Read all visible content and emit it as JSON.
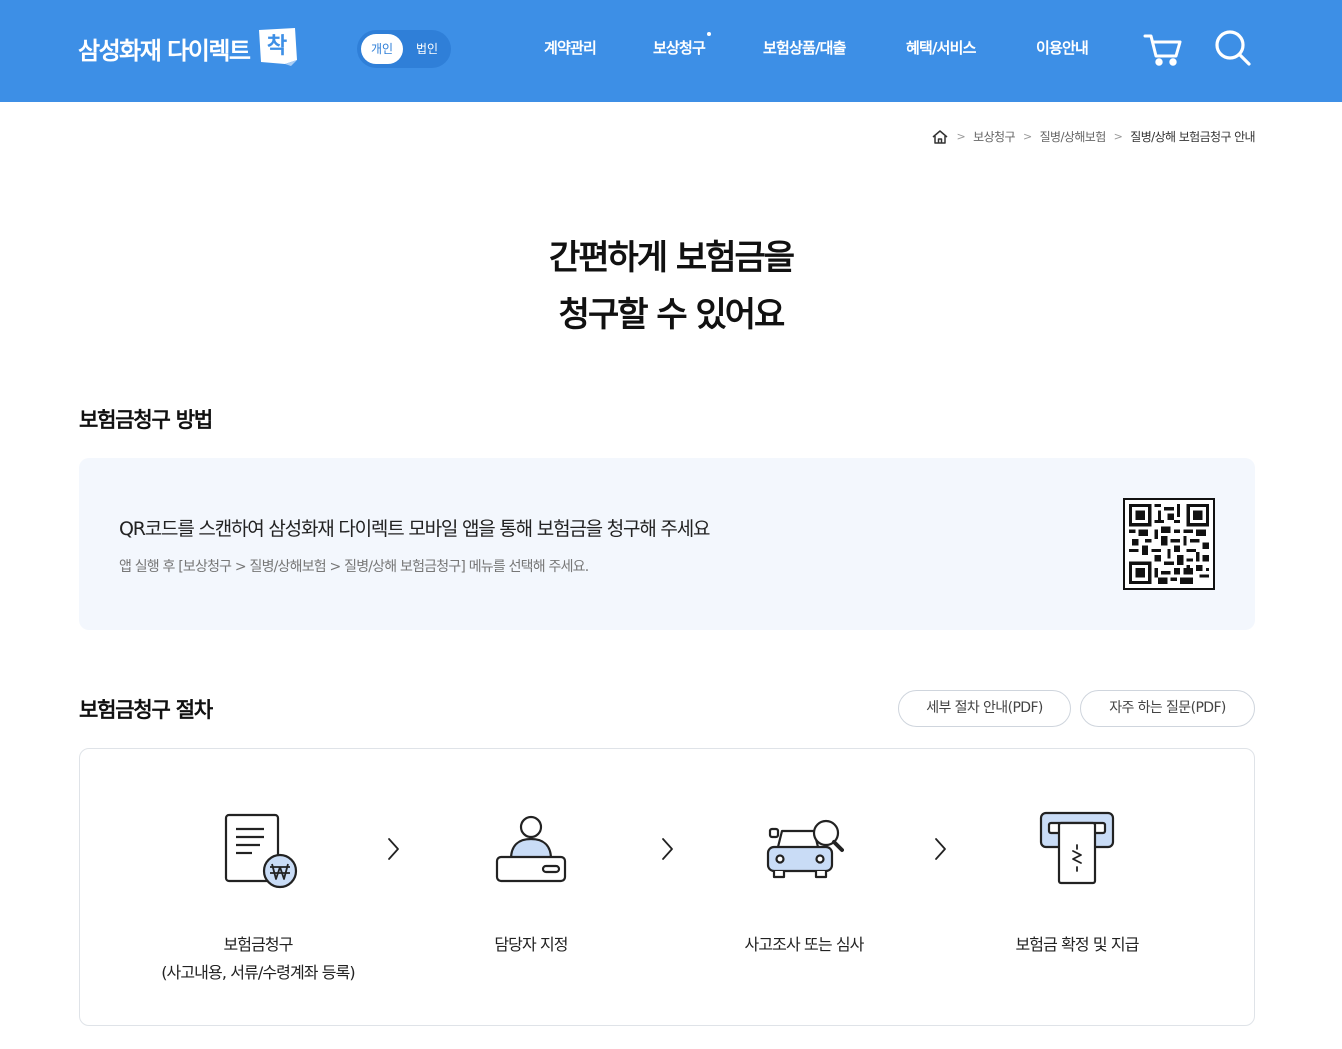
{
  "header": {
    "logo_text": "삼성화재 다이렉트",
    "logo_badge": "착",
    "toggle": {
      "personal": "개인",
      "corporate": "법인"
    },
    "nav": [
      {
        "label": "계약관리",
        "has_dot": false
      },
      {
        "label": "보상청구",
        "has_dot": true
      },
      {
        "label": "보험상품/대출",
        "has_dot": false
      },
      {
        "label": "혜택/서비스",
        "has_dot": false
      },
      {
        "label": "이용안내",
        "has_dot": false
      }
    ],
    "icons": {
      "cart": "cart-icon",
      "search": "search-icon"
    }
  },
  "breadcrumb": {
    "home_icon": "home-icon",
    "items": [
      "보상청구",
      "질병/상해보험",
      "질병/상해 보험금청구 안내"
    ]
  },
  "hero": {
    "line1": "간편하게 보험금을",
    "line2": "청구할 수 있어요"
  },
  "method": {
    "title": "보험금청구 방법",
    "main_text": "QR코드를 스캔하여 삼성화재 다이렉트 모바일 앱을 통해 보험금을 청구해 주세요",
    "sub_text": "앱 실행 후 [보상청구 > 질병/상해보험 > 질병/상해 보험금청구] 메뉴를 선택해 주세요.",
    "qr_icon": "qr-code"
  },
  "procedure": {
    "title": "보험금청구 절차",
    "buttons": {
      "detail_pdf": "세부 절차 안내(PDF)",
      "faq_pdf": "자주 하는 질문(PDF)"
    },
    "steps": [
      {
        "line1": "보험금청구",
        "line2": "(사고내용, 서류/수령계좌 등록)",
        "icon": "document-won-icon"
      },
      {
        "line1": "담당자 지정",
        "line2": "",
        "icon": "person-desk-icon"
      },
      {
        "line1": "사고조사 또는 심사",
        "line2": "",
        "icon": "car-magnifier-icon"
      },
      {
        "line1": "보험금 확정 및 지급",
        "line2": "",
        "icon": "receipt-payout-icon"
      }
    ]
  },
  "colors": {
    "brand": "#3d8fe6",
    "panel": "#f3f7fd",
    "icon_fill": "#c9dcf6",
    "icon_stroke": "#222222"
  }
}
